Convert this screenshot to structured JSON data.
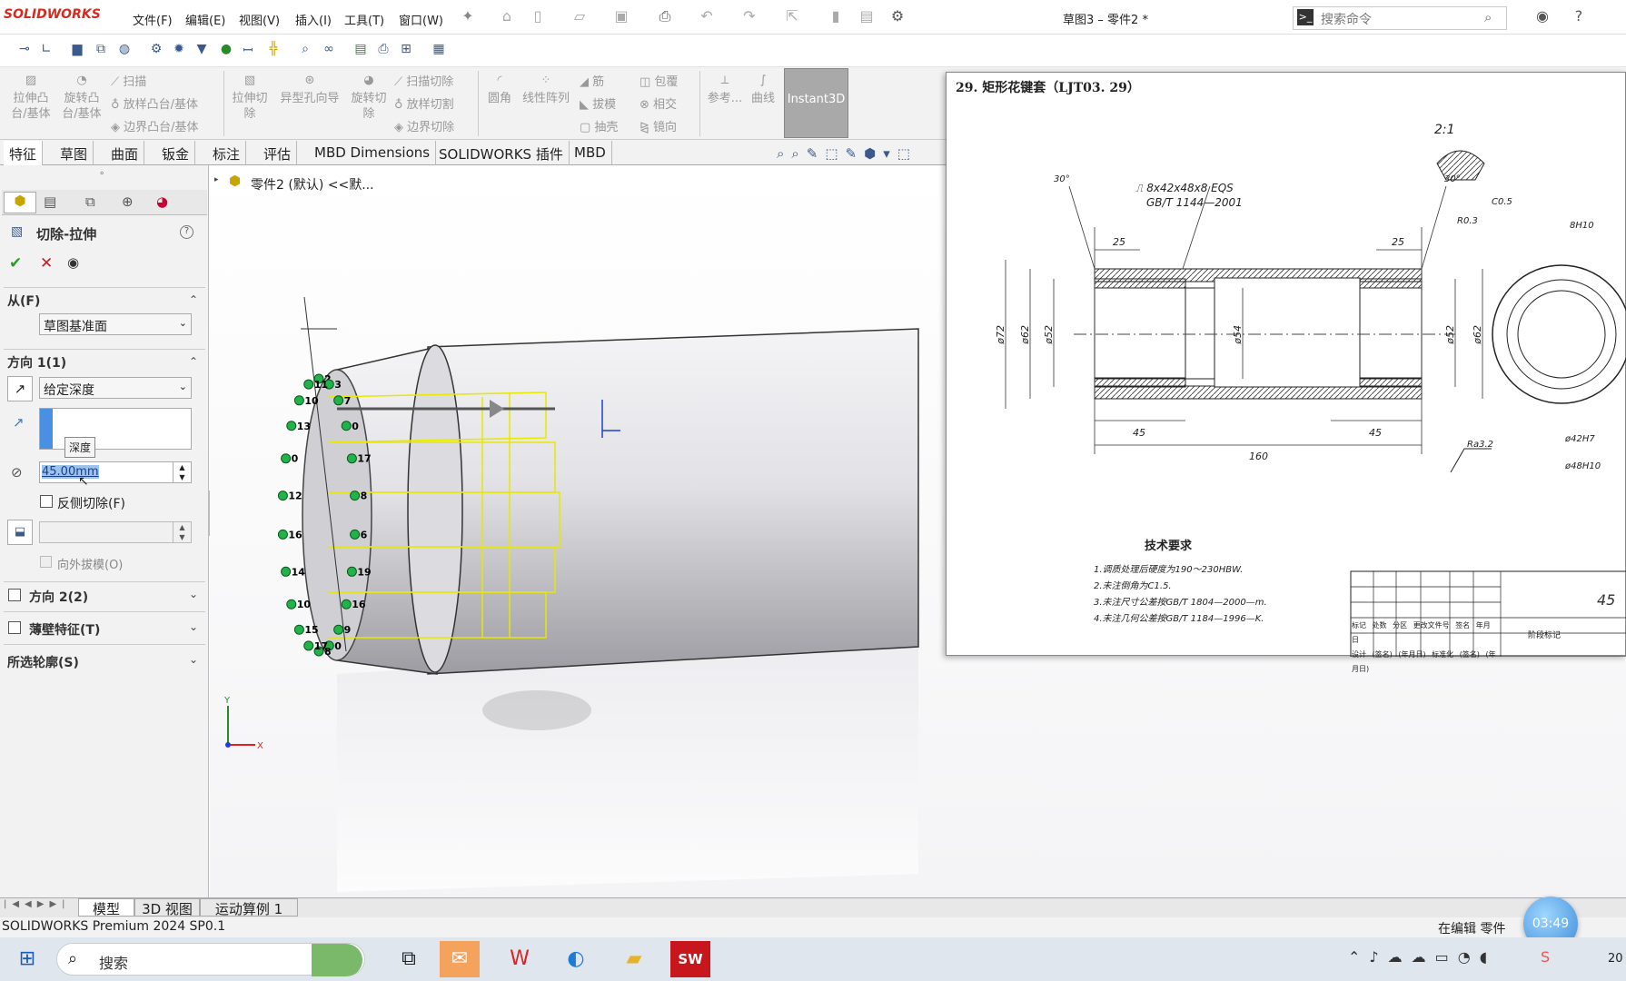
{
  "app": {
    "logo": "SOLIDWORKS",
    "doc_title": "草图3 – 零件2 *"
  },
  "menu": [
    "文件(F)",
    "编辑(E)",
    "视图(V)",
    "插入(I)",
    "工具(T)",
    "窗口(W)"
  ],
  "search": {
    "placeholder": "搜索命令"
  },
  "ribbon": {
    "extrude_boss": "拉伸凸\n台/基体",
    "revolve_boss": "旋转凸\n台/基体",
    "sweep": "扫描",
    "loft": "放样凸台/基体",
    "boundary": "边界凸台/基体",
    "extrude_cut": "拉伸切\n除",
    "hole_wizard": "异型孔向导",
    "revolve_cut": "旋转切\n除",
    "swept_cut": "扫描切除",
    "lofted_cut": "放样切割",
    "boundary_cut": "边界切除",
    "fillet": "圆角",
    "linear_pattern": "线性阵列",
    "rib": "筋",
    "draft": "拔模",
    "shell": "抽壳",
    "wrap": "包覆",
    "intersect": "相交",
    "mirror": "镜向",
    "reference": "参考...",
    "curves": "曲线",
    "instant3d": "Instant3D"
  },
  "tabs": [
    "特征",
    "草图",
    "曲面",
    "钣金",
    "标注",
    "评估",
    "MBD Dimensions",
    "SOLIDWORKS 插件",
    "MBD"
  ],
  "tree_root": "零件2 (默认) <<默...",
  "pm": {
    "title": "切除-拉伸",
    "from_header": "从(F)",
    "from_value": "草图基准面",
    "dir1_header": "方向 1(1)",
    "end_condition": "给定深度",
    "tooltip": "深度",
    "depth_value": "45.00mm",
    "flip_side": "反侧切除(F)",
    "draft_outward": "向外拔模(O)",
    "dir2": "方向 2(2)",
    "thin": "薄壁特征(T)",
    "contours": "所选轮廓(S)"
  },
  "drawing": {
    "heading": "29. 矩形花键套（LJT03. 29）",
    "scale_label": "2:1",
    "spline_spec": "⎍ 8x42x48x8 EQS",
    "std": "GB/T 1144—2001",
    "angle": "30°",
    "dims": [
      "25",
      "25",
      "ø72",
      "ø62",
      "ø52",
      "ø54",
      "ø52",
      "ø62",
      "45",
      "45",
      "160"
    ],
    "detail": [
      "C0.5",
      "R0.3",
      "8H10",
      "ø42H7",
      "ø48H10"
    ],
    "roughness": "Ra3.2",
    "tech_title": "技术要求",
    "tech_notes": [
      "1.调质处理后硬度为190～230HBW.",
      "2.未注倒角为C1.5.",
      "3.未注尺寸公差按GB/T 1804—2000—m.",
      "4.未注几何公差按GB/T 1184—1996—K."
    ],
    "title_block": [
      "标记",
      "处数",
      "分区",
      "更改文件号",
      "签名",
      "年月日",
      "设计",
      "(签名)",
      "(年月日)",
      "标准化",
      "(签名)",
      "(年月日)",
      "阶段标记"
    ],
    "block_num": "45"
  },
  "bottom_tabs": [
    "模型",
    "3D 视图",
    "运动算例 1"
  ],
  "status": {
    "left": "SOLIDWORKS Premium 2024 SP0.1",
    "right": "在编辑 零件",
    "clock": "03:49"
  },
  "taskbar": {
    "search": "搜索",
    "time": "20"
  },
  "feature_numbers": [
    "2",
    "3",
    "7",
    "0",
    "17",
    "8",
    "6",
    "19",
    "16",
    "9",
    "0",
    "8",
    "17",
    "15",
    "10",
    "14",
    "16",
    "12",
    "0",
    "13",
    "10",
    "11"
  ],
  "axis": {
    "x": "X",
    "y": "Y"
  }
}
